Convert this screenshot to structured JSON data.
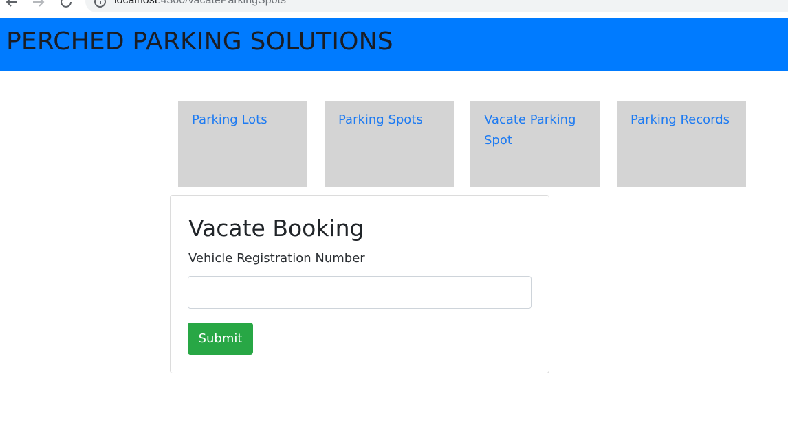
{
  "browser": {
    "url_host": "localhost",
    "url_path": ":4300/vacateParkingSpots"
  },
  "app": {
    "title": "PERCHED PARKING SOLUTIONS",
    "header_color": "#007bff"
  },
  "nav_tiles": [
    {
      "label": "Parking Lots"
    },
    {
      "label": "Parking Spots"
    },
    {
      "label": "Vacate Parking Spot"
    },
    {
      "label": "Parking Records"
    }
  ],
  "form": {
    "title": "Vacate Booking",
    "field_label": "Vehicle Registration Number",
    "field_value": "",
    "submit_label": "Submit",
    "submit_color": "#28a745"
  },
  "icons": {
    "back": "arrow-left-icon",
    "forward": "arrow-right-icon",
    "reload": "reload-icon",
    "site_info": "info-icon"
  }
}
